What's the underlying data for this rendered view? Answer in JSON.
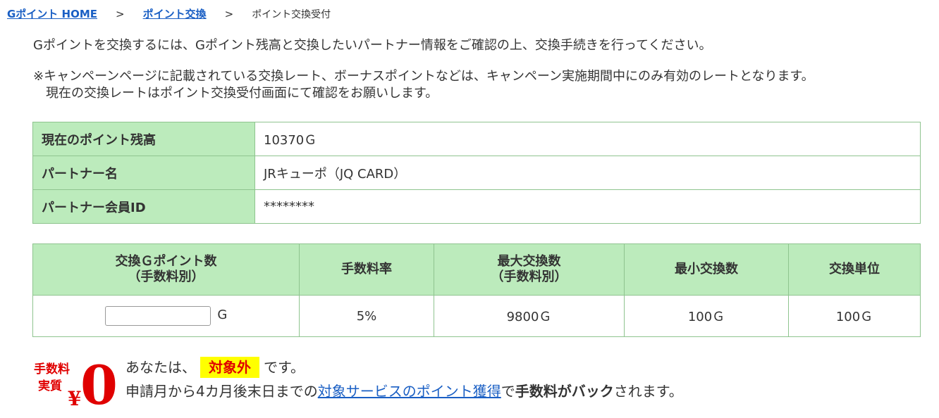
{
  "breadcrumb": {
    "home": "Gポイント HOME",
    "sep1": ">",
    "exchange": "ポイント交換",
    "sep2": ">",
    "current": "ポイント交換受付"
  },
  "intro": "Gポイントを交換するには、Gポイント残高と交換したいパートナー情報をご確認の上、交換手続きを行ってください。",
  "note": {
    "line1": "※キャンペーンページに記載されている交換レート、ボーナスポイントなどは、キャンペーン実施期間中にのみ有効のレートとなります。",
    "line2": "現在の交換レートはポイント交換受付画面にて確認をお願いします。"
  },
  "info": {
    "balance_label": "現在のポイント残高",
    "balance_value": "10370Ｇ",
    "partner_label": "パートナー名",
    "partner_value": "JRキューポ（JQ CARD）",
    "member_label": "パートナー会員ID",
    "member_value": "********"
  },
  "exchange_table": {
    "headers": {
      "amount_l1": "交換Ｇポイント数",
      "amount_l2": "（手数料別）",
      "fee_rate": "手数料率",
      "max_l1": "最大交換数",
      "max_l2": "（手数料別）",
      "min": "最小交換数",
      "unit": "交換単位"
    },
    "row": {
      "amount_value": "",
      "amount_unit": "G",
      "fee_rate": "5%",
      "max": "9800Ｇ",
      "min": "100Ｇ",
      "unit": "100Ｇ"
    }
  },
  "promo": {
    "icon_text_line1": "手数料",
    "icon_text_line2": "実質",
    "icon_yen": "¥",
    "icon_zero": "0",
    "prefix": "あなたは、",
    "badge": "対象外",
    "suffix": "です。",
    "line2_start": "申請月から4カ月後末日までの",
    "line2_link": "対象サービスのポイント獲得",
    "line2_mid": "で",
    "line2_bold": "手数料がバック",
    "line2_end": "されます。"
  },
  "colors": {
    "header_bg": "#bcebbc",
    "border": "#8fc48f",
    "link": "#1a5fc4",
    "badge_bg": "#ffff00",
    "badge_text": "#e00000"
  }
}
